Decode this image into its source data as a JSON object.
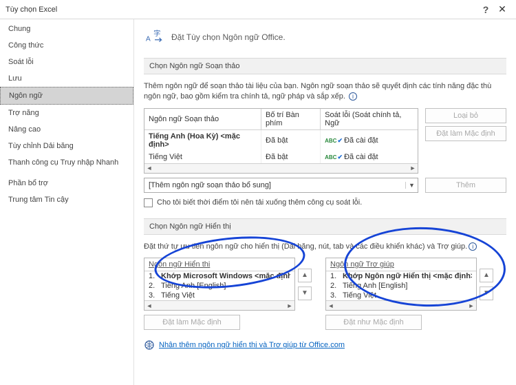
{
  "window": {
    "title": "Tùy chọn Excel",
    "help": "?",
    "close": "✕"
  },
  "sidebar": {
    "items": [
      "Chung",
      "Công thức",
      "Soát lỗi",
      "Lưu",
      "Ngôn ngữ",
      "Trợ năng",
      "Nâng cao",
      "Tùy chỉnh Dải băng",
      "Thanh công cụ Truy nhập Nhanh",
      "Phần bổ trợ",
      "Trung tâm Tin cậy"
    ],
    "selected": 4
  },
  "page": {
    "heading": "Đặt Tùy chọn Ngôn ngữ Office."
  },
  "edit_section": {
    "title": "Chọn Ngôn ngữ Soạn thảo",
    "desc": "Thêm ngôn ngữ để soạn thảo tài liệu của bạn. Ngôn ngữ soạn thảo sẽ quyết định các tính năng đặc thù ngôn ngữ, bao gồm kiểm tra chính tả, ngữ pháp và sắp xếp.",
    "cols": {
      "lang": "Ngôn ngữ Soạn thảo",
      "kb": "Bố trí Bàn phím",
      "proof": "Soát lỗi (Soát chính tả, Ngữ"
    },
    "rows": [
      {
        "lang": "Tiếng Anh (Hoa Kỳ) <mặc định>",
        "kb": "Đã bật",
        "proof": "Đã cài đặt",
        "bold": true
      },
      {
        "lang": "Tiếng Việt",
        "kb": "Đã bật",
        "proof": "Đã cài đặt",
        "bold": false
      }
    ],
    "buttons": {
      "remove": "Loại bỏ",
      "setdefault": "Đặt làm Mặc định"
    },
    "add_combo": "[Thêm ngôn ngữ soạn thảo bổ sung]",
    "add_btn": "Thêm",
    "checkbox": "Cho tôi biết thời điểm tôi nên tải xuống thêm công cụ soát lỗi."
  },
  "display_section": {
    "title": "Chọn Ngôn ngữ Hiển thị",
    "desc": "Đặt thứ tự ưu tiên ngôn ngữ cho hiển thị (Dải băng, nút, tab và các điều khiển khác) và Trợ giúp.",
    "left": {
      "head": "Ngôn ngữ Hiển thị",
      "rows": [
        {
          "n": "1.",
          "t": "Khớp Microsoft Windows <mặc định>",
          "bold": true
        },
        {
          "n": "2.",
          "t": "Tiếng Anh [English]"
        },
        {
          "n": "3.",
          "t": "Tiếng Việt"
        }
      ],
      "setdefault": "Đặt làm Mặc định"
    },
    "right": {
      "head": "Ngôn ngữ Trợ giúp",
      "rows": [
        {
          "n": "1.",
          "t": "Khớp Ngôn ngữ Hiển thị <mặc định>",
          "bold": true
        },
        {
          "n": "2.",
          "t": "Tiếng Anh [English]"
        },
        {
          "n": "3.",
          "t": "Tiếng Việt"
        }
      ],
      "setdefault": "Đặt như Mặc định"
    },
    "link": "Nhận thêm ngôn ngữ hiển thị và Trợ giúp từ Office.com"
  },
  "arrows": {
    "up": "▲",
    "down": "▼",
    "left": "◄",
    "right": "►"
  }
}
